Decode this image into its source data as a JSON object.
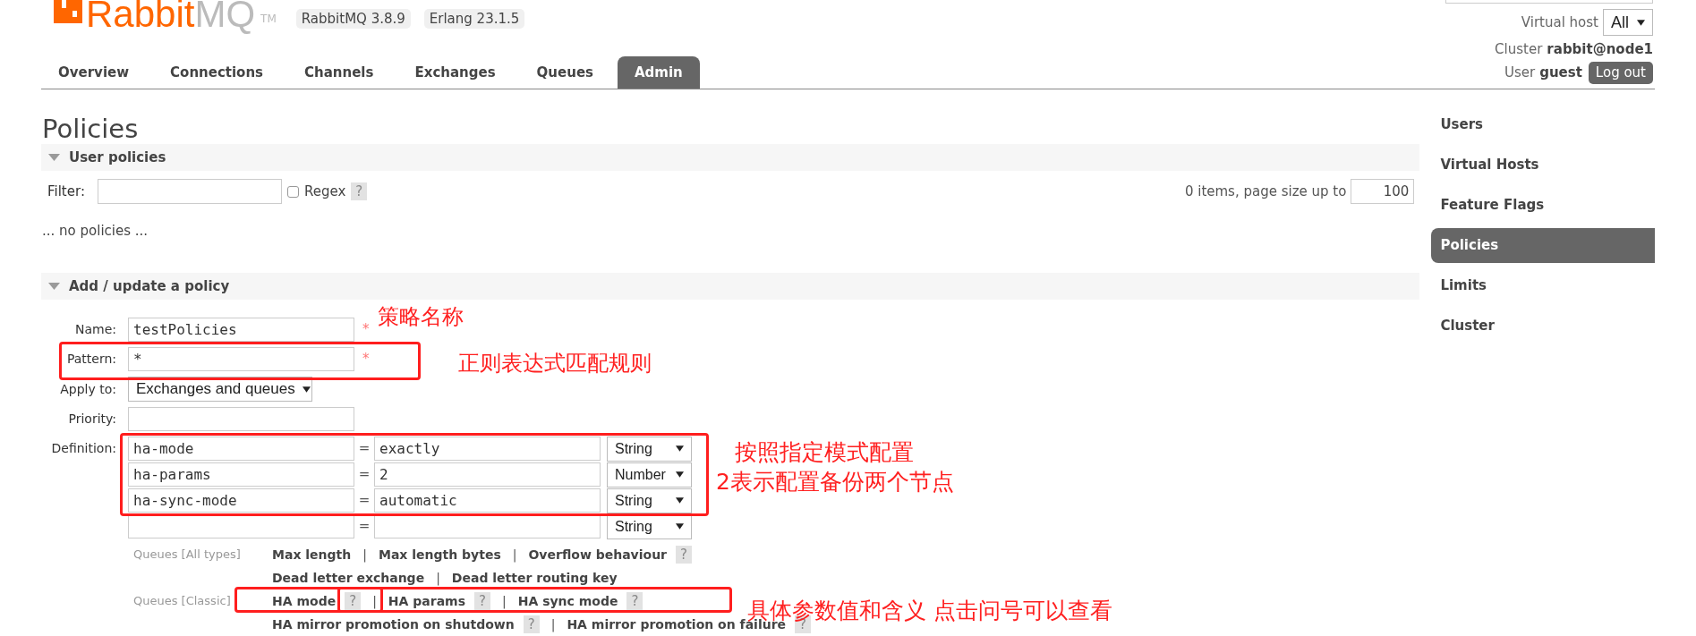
{
  "header": {
    "logo": {
      "primary": "Rabbit",
      "secondary": "MQ",
      "trademark": "TM"
    },
    "versions": [
      "RabbitMQ 3.8.9",
      "Erlang 23.1.5"
    ]
  },
  "tabs": [
    {
      "label": "Overview",
      "selected": false
    },
    {
      "label": "Connections",
      "selected": false
    },
    {
      "label": "Channels",
      "selected": false
    },
    {
      "label": "Exchanges",
      "selected": false
    },
    {
      "label": "Queues",
      "selected": false
    },
    {
      "label": "Admin",
      "selected": true
    }
  ],
  "user_panel": {
    "virtual_host": {
      "label": "Virtual host",
      "value": "All"
    },
    "cluster": {
      "label": "Cluster",
      "value": "rabbit@node1"
    },
    "user": {
      "label": "User",
      "value": "guest"
    },
    "logout": "Log out"
  },
  "page_title": "Policies",
  "user_policies": {
    "title": "User policies",
    "expanded": true,
    "filter": {
      "label": "Filter:"
    },
    "regex": {
      "label": "Regex",
      "checked": false,
      "help": "?"
    },
    "paging": {
      "label": "0 items, page size up to",
      "page_size": "100"
    },
    "empty_message": "... no policies ..."
  },
  "add_policy": {
    "title": "Add / update a policy",
    "expanded": true,
    "fields": [
      {
        "label": "Name:",
        "kind": "text",
        "value": "testPolicies",
        "required_mark": "*"
      },
      {
        "label": "Pattern:",
        "kind": "text",
        "value": "*",
        "required_mark": "*"
      },
      {
        "label": "Apply to:",
        "kind": "select",
        "value": "Exchanges and queues"
      },
      {
        "label": "Priority:",
        "kind": "text"
      }
    ],
    "definition": {
      "label": "Definition:",
      "rows": [
        {
          "key": "ha-mode",
          "equals": "=",
          "value": "exactly",
          "type": "String"
        },
        {
          "key": "ha-params",
          "equals": "=",
          "value": "2",
          "type": "Number"
        },
        {
          "key": "ha-sync-mode",
          "equals": "=",
          "value": "automatic",
          "type": "String"
        },
        {
          "equals": "=",
          "type": "String"
        }
      ]
    },
    "hints": [
      {
        "label": "Queues [All types]",
        "lines": [
          [
            {
              "kind": "link",
              "text": "Max length"
            },
            {
              "kind": "separator",
              "text": "|"
            },
            {
              "kind": "link",
              "text": "Max length bytes"
            },
            {
              "kind": "separator",
              "text": "|"
            },
            {
              "kind": "link",
              "text": "Overflow behaviour"
            },
            {
              "kind": "help",
              "text": "?"
            }
          ],
          [
            {
              "kind": "link",
              "text": "Dead letter exchange"
            },
            {
              "kind": "separator",
              "text": "|"
            },
            {
              "kind": "link",
              "text": "Dead letter routing key"
            }
          ]
        ]
      },
      {
        "label": "Queues [Classic]",
        "lines": [
          [
            {
              "kind": "link",
              "text": "HA mode"
            },
            {
              "kind": "help",
              "text": "?"
            },
            {
              "kind": "separator",
              "text": "|"
            },
            {
              "kind": "link",
              "text": "HA params"
            },
            {
              "kind": "help",
              "text": "?"
            },
            {
              "kind": "separator",
              "text": "|"
            },
            {
              "kind": "link",
              "text": "HA sync mode"
            },
            {
              "kind": "help",
              "text": "?"
            }
          ],
          [
            {
              "kind": "link",
              "text": "HA mirror promotion on shutdown"
            },
            {
              "kind": "help",
              "text": "?"
            },
            {
              "kind": "separator",
              "text": "|"
            },
            {
              "kind": "link",
              "text": "HA mirror promotion on failure"
            },
            {
              "kind": "help",
              "text": "?"
            }
          ]
        ]
      }
    ]
  },
  "sidebar": {
    "items": [
      {
        "label": "Users",
        "selected": false
      },
      {
        "label": "Virtual Hosts",
        "selected": false
      },
      {
        "label": "Feature Flags",
        "selected": false
      },
      {
        "label": "Policies",
        "selected": true
      },
      {
        "label": "Limits",
        "selected": false
      },
      {
        "label": "Cluster",
        "selected": false
      }
    ]
  },
  "annotations": [
    "策略名称",
    "正则表达式匹配规则",
    "按照指定模式配置",
    "2表示配置备份两个节点",
    "具体参数值和含义 点击问号可以查看"
  ]
}
